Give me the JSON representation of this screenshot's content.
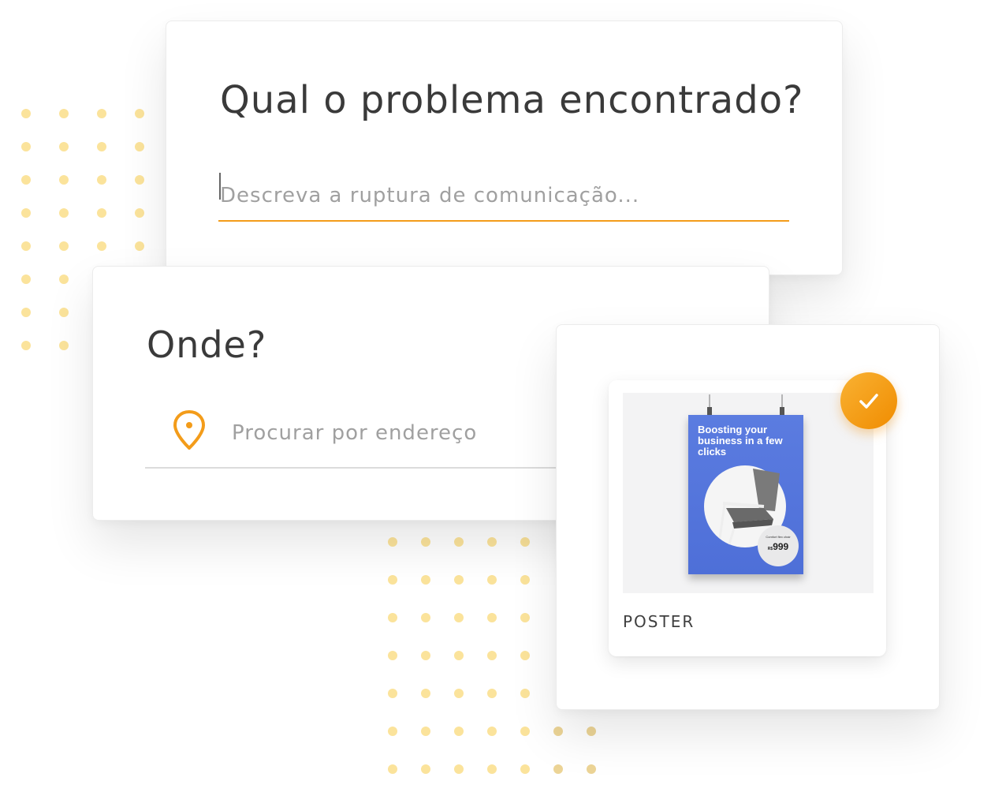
{
  "problem": {
    "title": "Qual o problema encontrado?",
    "placeholder": "Descreva a ruptura de comunicação..."
  },
  "where": {
    "title": "Onde?",
    "placeholder": "Procurar por endereço",
    "icon": "map-pin-icon"
  },
  "poster_option": {
    "label": "POSTER",
    "selected": true,
    "check_icon": "check-icon",
    "preview": {
      "headline": "Boosting your business in a few clicks",
      "caption": "Comfort flex chair",
      "currency": "R$",
      "price": "999"
    }
  },
  "colors": {
    "accent": "#f39c1a",
    "dots": "#fbe39b",
    "poster_blue": "#5b7ce0"
  }
}
